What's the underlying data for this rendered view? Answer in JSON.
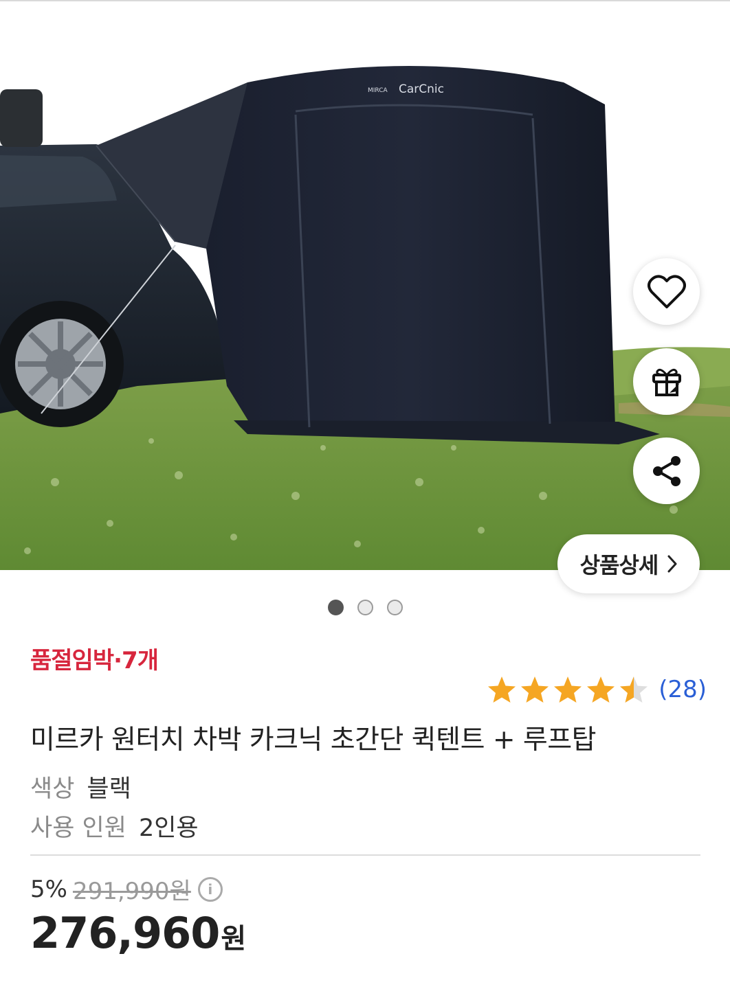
{
  "product_image": {
    "alt": "MIRCA CarCnic tent attached to car",
    "brand_text": "MIRCA CarCnic"
  },
  "actions": {
    "wishlist_icon": "heart-icon",
    "gift_icon": "gift-icon",
    "share_icon": "share-icon",
    "detail_label": "상품상세",
    "detail_chevron": "chevron-right-icon"
  },
  "carousel": {
    "total": 3,
    "active": 1
  },
  "stock_notice": "품절임박·7개",
  "rating": {
    "value": 4.5,
    "max": 5,
    "count_label": "(28)",
    "star_color": "#f5a623"
  },
  "title": "미르카 원터치 차박 카크닉 초간단 퀵텐트 + 루프탑",
  "options": [
    {
      "key": "색상",
      "value": "블랙"
    },
    {
      "key": "사용 인원",
      "value": "2인용"
    }
  ],
  "price": {
    "discount_rate": "5%",
    "original": "291,990원",
    "sale_amount": "276,960",
    "sale_unit": "원",
    "info_icon": "info-icon"
  },
  "colors": {
    "stock_red": "#d7263d",
    "review_blue": "#2a5fd6"
  }
}
